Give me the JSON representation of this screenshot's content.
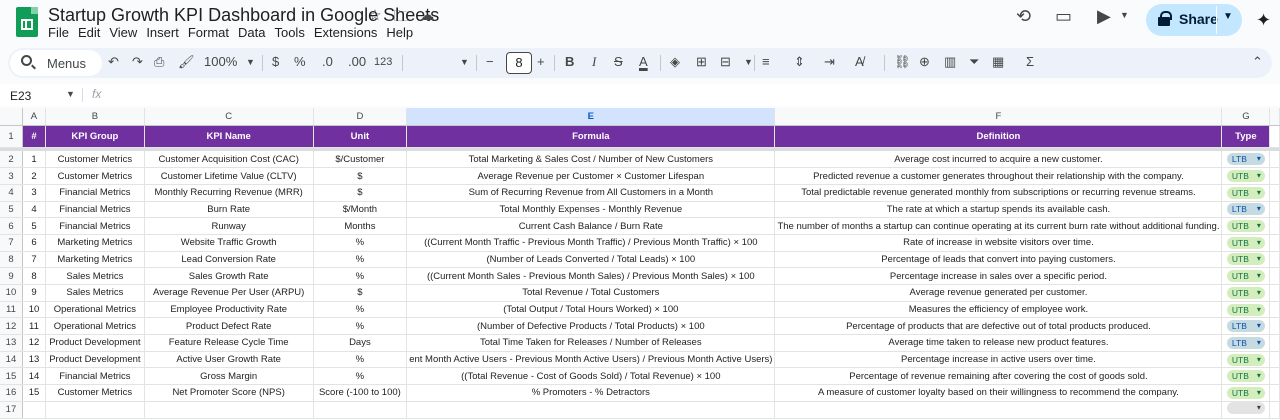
{
  "doc": {
    "title": "Startup Growth KPI Dashboard in Google Sheets"
  },
  "menu": [
    "File",
    "Edit",
    "View",
    "Insert",
    "Format",
    "Data",
    "Tools",
    "Extensions",
    "Help"
  ],
  "share": {
    "label": "Share"
  },
  "toolbar": {
    "menus_label": "Menus",
    "zoom": "100%",
    "currency": "$",
    "percent": "%",
    "dec_decrease": ".0",
    "dec_increase": ".00",
    "number_format": "123",
    "font_size": "8"
  },
  "formula_bar": {
    "cell_ref": "E23",
    "fx": "fx",
    "value": ""
  },
  "grid": {
    "columns": [
      "A",
      "B",
      "C",
      "D",
      "E",
      "F",
      "G"
    ],
    "header": [
      "#",
      "KPI Group",
      "KPI Name",
      "Unit",
      "Formula",
      "Definition",
      "Type"
    ],
    "rows": [
      {
        "n": "1",
        "group": "Customer Metrics",
        "name": "Customer Acquisition Cost (CAC)",
        "unit": "$/Customer",
        "formula": "Total Marketing & Sales Cost / Number of New Customers",
        "definition": "Average cost incurred to acquire a new customer.",
        "type": "LTB"
      },
      {
        "n": "2",
        "group": "Customer Metrics",
        "name": "Customer Lifetime Value (CLTV)",
        "unit": "$",
        "formula": "Average Revenue per Customer × Customer Lifespan",
        "definition": "Predicted revenue a customer generates throughout their relationship with the company.",
        "type": "UTB"
      },
      {
        "n": "3",
        "group": "Financial Metrics",
        "name": "Monthly Recurring Revenue (MRR)",
        "unit": "$",
        "formula": "Sum of Recurring Revenue from All Customers in a Month",
        "definition": "Total predictable revenue generated monthly from subscriptions or recurring revenue streams.",
        "type": "UTB"
      },
      {
        "n": "4",
        "group": "Financial Metrics",
        "name": "Burn Rate",
        "unit": "$/Month",
        "formula": "Total Monthly Expenses - Monthly Revenue",
        "definition": "The rate at which a startup spends its available cash.",
        "type": "LTB"
      },
      {
        "n": "5",
        "group": "Financial Metrics",
        "name": "Runway",
        "unit": "Months",
        "formula": "Current Cash Balance / Burn Rate",
        "definition": "The number of months a startup can continue operating at its current burn rate without additional funding.",
        "type": "UTB"
      },
      {
        "n": "6",
        "group": "Marketing Metrics",
        "name": "Website Traffic Growth",
        "unit": "%",
        "formula": "((Current Month Traffic - Previous Month Traffic) / Previous Month Traffic) × 100",
        "definition": "Rate of increase in website visitors over time.",
        "type": "UTB"
      },
      {
        "n": "7",
        "group": "Marketing Metrics",
        "name": "Lead Conversion Rate",
        "unit": "%",
        "formula": "(Number of Leads Converted / Total Leads) × 100",
        "definition": "Percentage of leads that convert into paying customers.",
        "type": "UTB"
      },
      {
        "n": "8",
        "group": "Sales Metrics",
        "name": "Sales Growth Rate",
        "unit": "%",
        "formula": "((Current Month Sales - Previous Month Sales) / Previous Month Sales) × 100",
        "definition": "Percentage increase in sales over a specific period.",
        "type": "UTB"
      },
      {
        "n": "9",
        "group": "Sales Metrics",
        "name": "Average Revenue Per User (ARPU)",
        "unit": "$",
        "formula": "Total Revenue / Total Customers",
        "definition": "Average revenue generated per customer.",
        "type": "UTB"
      },
      {
        "n": "10",
        "group": "Operational Metrics",
        "name": "Employee Productivity Rate",
        "unit": "%",
        "formula": "(Total Output / Total Hours Worked) × 100",
        "definition": "Measures the efficiency of employee work.",
        "type": "UTB"
      },
      {
        "n": "11",
        "group": "Operational Metrics",
        "name": "Product Defect Rate",
        "unit": "%",
        "formula": "(Number of Defective Products / Total Products) × 100",
        "definition": "Percentage of products that are defective out of total products produced.",
        "type": "LTB"
      },
      {
        "n": "12",
        "group": "Product Development",
        "name": "Feature Release Cycle Time",
        "unit": "Days",
        "formula": "Total Time Taken for Releases / Number of Releases",
        "definition": "Average time taken to release new product features.",
        "type": "LTB"
      },
      {
        "n": "13",
        "group": "Product Development",
        "name": "Active User Growth Rate",
        "unit": "%",
        "formula": "ent Month Active Users - Previous Month Active Users) / Previous Month Active Users)",
        "definition": "Percentage increase in active users over time.",
        "type": "UTB"
      },
      {
        "n": "14",
        "group": "Financial Metrics",
        "name": "Gross Margin",
        "unit": "%",
        "formula": "((Total Revenue - Cost of Goods Sold) / Total Revenue) × 100",
        "definition": "Percentage of revenue remaining after covering the cost of goods sold.",
        "type": "UTB"
      },
      {
        "n": "15",
        "group": "Customer Metrics",
        "name": "Net Promoter Score (NPS)",
        "unit": "Score (-100 to 100)",
        "formula": "% Promoters - % Detractors",
        "definition": "A measure of customer loyalty based on their willingness to recommend the company.",
        "type": "UTB"
      }
    ]
  }
}
